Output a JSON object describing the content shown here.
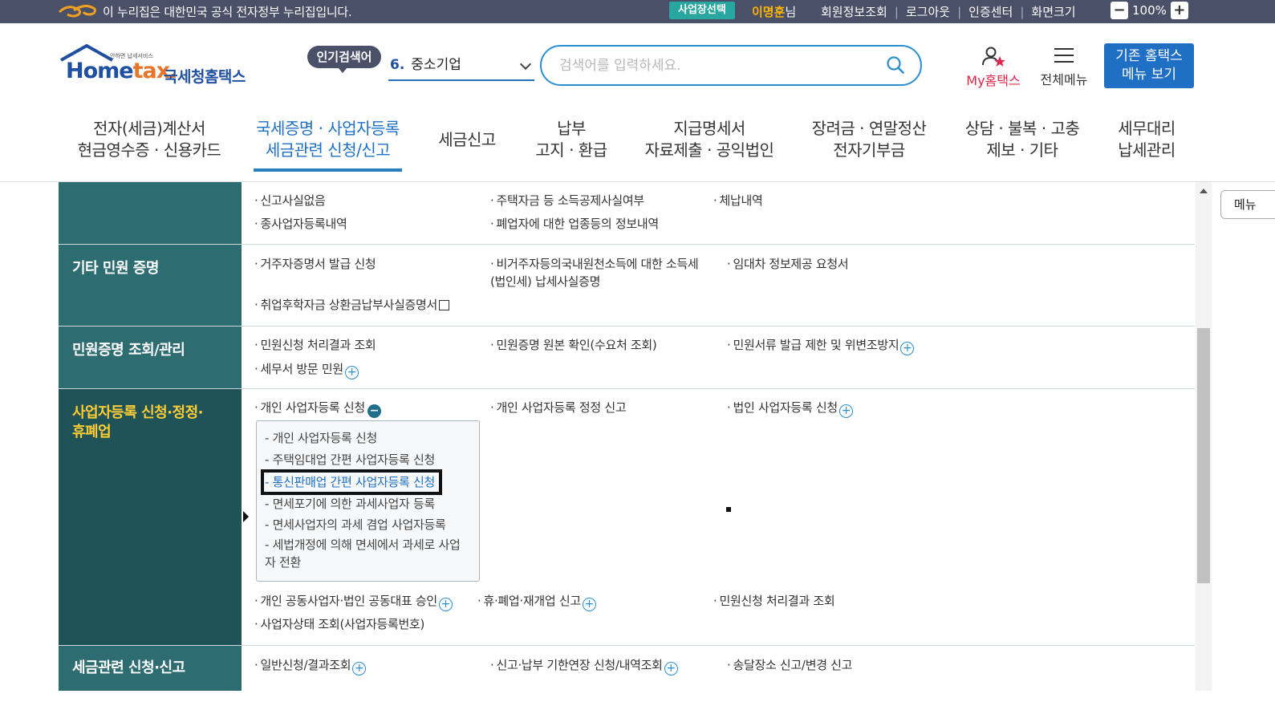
{
  "govbar": {
    "notice": "이 누리집은 대한민국 공식 전자정부 누리집입니다.",
    "biz_select": "사업장선택",
    "user_name": "이명훈",
    "user_suffix": "님",
    "links": [
      "회원정보조회",
      "로그아웃",
      "인증센터",
      "화면크기"
    ],
    "zoom_minus": "−",
    "zoom_value": "100%",
    "zoom_plus": "+"
  },
  "header": {
    "brand_small": "안하면 납세서비스",
    "brand_home": "Home",
    "brand_tax": "tax.",
    "brand_kr": "국세청홈택스",
    "popular_tag": "인기검색어",
    "popular_num": "6.",
    "popular_value": "중소기업",
    "search_placeholder": "검색어를 입력하세요.",
    "mytax": "My홈택스",
    "allmenu": "전체메뉴",
    "oldmenu_line1": "기존 홈택스",
    "oldmenu_line2": "메뉴 보기"
  },
  "gnb": [
    {
      "l1": "전자(세금)계산서",
      "l2": "현금영수증 · 신용카드"
    },
    {
      "l1": "국세증명 · 사업자등록",
      "l2": "세금관련 신청/신고"
    },
    {
      "l1": "세금신고",
      "l2": ""
    },
    {
      "l1": "납부",
      "l2": "고지 · 환급"
    },
    {
      "l1": "지급명세서",
      "l2": "자료제출 · 공익법인"
    },
    {
      "l1": "장려금 · 연말정산",
      "l2": "전자기부금"
    },
    {
      "l1": "상담 · 불복 · 고충",
      "l2": "제보 · 기타"
    },
    {
      "l1": "세무대리",
      "l2": "납세관리"
    }
  ],
  "rows": {
    "top": {
      "links": [
        "신고사실없음",
        "주택자금 등 소득공제사실여부",
        "체납내역",
        "종사업자등록내역",
        "폐업자에 대한 업종등의 정보내역"
      ]
    },
    "etc": {
      "label": "기타 민원 증명",
      "links": [
        "거주자증명서 발급 신청",
        "비거주자등의국내원천소득에 대한 소득세(법인세) 납세사실증명",
        "임대차 정보제공 요청서",
        "취업후학자금 상환금납부사실증명서"
      ]
    },
    "manage": {
      "label": "민원증명 조회/관리",
      "links": [
        "민원신청 처리결과 조회",
        "민원증명 원본 확인(수요처 조회)",
        "민원서류 발급 제한 및 위변조방지",
        "세무서 방문 민원"
      ]
    },
    "bizreg": {
      "label_line1": "사업자등록 신청·정정·",
      "label_line2": "휴폐업",
      "links": [
        "개인 사업자등록 신청",
        "개인 사업자등록 정정 신고",
        "법인 사업자등록 신청",
        "개인 공동사업자·법인 공동대표 승인",
        "휴·폐업·재개업 신고",
        "민원신청 처리결과 조회",
        "사업자상태 조회(사업자등록번호)"
      ],
      "submenu": [
        "개인 사업자등록 신청",
        "주택임대업 간편 사업자등록 신청",
        "통신판매업 간편 사업자등록 신청",
        "면세포기에 의한 과세사업자 등록",
        "면세사업자의 과세 겸업 사업자등록",
        "세법개정에 의해 면세에서 과세로 사업자 전환"
      ]
    },
    "taxapp": {
      "label": "세금관련 신청·신고",
      "links": [
        "일반신청/결과조회",
        "신고·납부 기한연장 신청/내역조회",
        "송달장소 신고/변경 신고"
      ]
    }
  },
  "side_menu": "메뉴",
  "colors": {
    "accent": "#1f6fc4",
    "sidebar": "#2d6d72",
    "active_label": "#ffcc33"
  }
}
